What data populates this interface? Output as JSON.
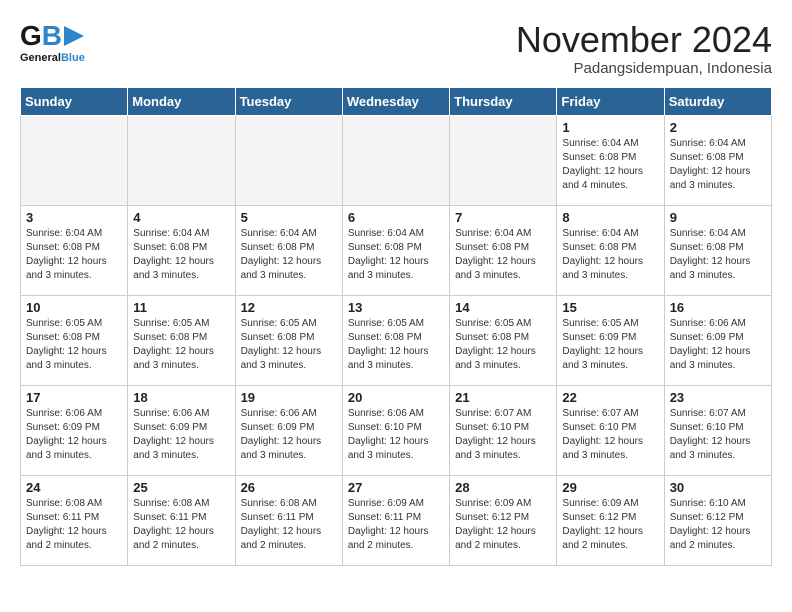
{
  "header": {
    "logo_general": "General",
    "logo_blue": "Blue",
    "month_title": "November 2024",
    "location": "Padangsidempuan, Indonesia"
  },
  "weekdays": [
    "Sunday",
    "Monday",
    "Tuesday",
    "Wednesday",
    "Thursday",
    "Friday",
    "Saturday"
  ],
  "weeks": [
    [
      {
        "day": "",
        "empty": true
      },
      {
        "day": "",
        "empty": true
      },
      {
        "day": "",
        "empty": true
      },
      {
        "day": "",
        "empty": true
      },
      {
        "day": "",
        "empty": true
      },
      {
        "day": "1",
        "sunrise": "Sunrise: 6:04 AM",
        "sunset": "Sunset: 6:08 PM",
        "daylight": "Daylight: 12 hours and 4 minutes."
      },
      {
        "day": "2",
        "sunrise": "Sunrise: 6:04 AM",
        "sunset": "Sunset: 6:08 PM",
        "daylight": "Daylight: 12 hours and 3 minutes."
      }
    ],
    [
      {
        "day": "3",
        "sunrise": "Sunrise: 6:04 AM",
        "sunset": "Sunset: 6:08 PM",
        "daylight": "Daylight: 12 hours and 3 minutes."
      },
      {
        "day": "4",
        "sunrise": "Sunrise: 6:04 AM",
        "sunset": "Sunset: 6:08 PM",
        "daylight": "Daylight: 12 hours and 3 minutes."
      },
      {
        "day": "5",
        "sunrise": "Sunrise: 6:04 AM",
        "sunset": "Sunset: 6:08 PM",
        "daylight": "Daylight: 12 hours and 3 minutes."
      },
      {
        "day": "6",
        "sunrise": "Sunrise: 6:04 AM",
        "sunset": "Sunset: 6:08 PM",
        "daylight": "Daylight: 12 hours and 3 minutes."
      },
      {
        "day": "7",
        "sunrise": "Sunrise: 6:04 AM",
        "sunset": "Sunset: 6:08 PM",
        "daylight": "Daylight: 12 hours and 3 minutes."
      },
      {
        "day": "8",
        "sunrise": "Sunrise: 6:04 AM",
        "sunset": "Sunset: 6:08 PM",
        "daylight": "Daylight: 12 hours and 3 minutes."
      },
      {
        "day": "9",
        "sunrise": "Sunrise: 6:04 AM",
        "sunset": "Sunset: 6:08 PM",
        "daylight": "Daylight: 12 hours and 3 minutes."
      }
    ],
    [
      {
        "day": "10",
        "sunrise": "Sunrise: 6:05 AM",
        "sunset": "Sunset: 6:08 PM",
        "daylight": "Daylight: 12 hours and 3 minutes."
      },
      {
        "day": "11",
        "sunrise": "Sunrise: 6:05 AM",
        "sunset": "Sunset: 6:08 PM",
        "daylight": "Daylight: 12 hours and 3 minutes."
      },
      {
        "day": "12",
        "sunrise": "Sunrise: 6:05 AM",
        "sunset": "Sunset: 6:08 PM",
        "daylight": "Daylight: 12 hours and 3 minutes."
      },
      {
        "day": "13",
        "sunrise": "Sunrise: 6:05 AM",
        "sunset": "Sunset: 6:08 PM",
        "daylight": "Daylight: 12 hours and 3 minutes."
      },
      {
        "day": "14",
        "sunrise": "Sunrise: 6:05 AM",
        "sunset": "Sunset: 6:08 PM",
        "daylight": "Daylight: 12 hours and 3 minutes."
      },
      {
        "day": "15",
        "sunrise": "Sunrise: 6:05 AM",
        "sunset": "Sunset: 6:09 PM",
        "daylight": "Daylight: 12 hours and 3 minutes."
      },
      {
        "day": "16",
        "sunrise": "Sunrise: 6:06 AM",
        "sunset": "Sunset: 6:09 PM",
        "daylight": "Daylight: 12 hours and 3 minutes."
      }
    ],
    [
      {
        "day": "17",
        "sunrise": "Sunrise: 6:06 AM",
        "sunset": "Sunset: 6:09 PM",
        "daylight": "Daylight: 12 hours and 3 minutes."
      },
      {
        "day": "18",
        "sunrise": "Sunrise: 6:06 AM",
        "sunset": "Sunset: 6:09 PM",
        "daylight": "Daylight: 12 hours and 3 minutes."
      },
      {
        "day": "19",
        "sunrise": "Sunrise: 6:06 AM",
        "sunset": "Sunset: 6:09 PM",
        "daylight": "Daylight: 12 hours and 3 minutes."
      },
      {
        "day": "20",
        "sunrise": "Sunrise: 6:06 AM",
        "sunset": "Sunset: 6:10 PM",
        "daylight": "Daylight: 12 hours and 3 minutes."
      },
      {
        "day": "21",
        "sunrise": "Sunrise: 6:07 AM",
        "sunset": "Sunset: 6:10 PM",
        "daylight": "Daylight: 12 hours and 3 minutes."
      },
      {
        "day": "22",
        "sunrise": "Sunrise: 6:07 AM",
        "sunset": "Sunset: 6:10 PM",
        "daylight": "Daylight: 12 hours and 3 minutes."
      },
      {
        "day": "23",
        "sunrise": "Sunrise: 6:07 AM",
        "sunset": "Sunset: 6:10 PM",
        "daylight": "Daylight: 12 hours and 3 minutes."
      }
    ],
    [
      {
        "day": "24",
        "sunrise": "Sunrise: 6:08 AM",
        "sunset": "Sunset: 6:11 PM",
        "daylight": "Daylight: 12 hours and 2 minutes."
      },
      {
        "day": "25",
        "sunrise": "Sunrise: 6:08 AM",
        "sunset": "Sunset: 6:11 PM",
        "daylight": "Daylight: 12 hours and 2 minutes."
      },
      {
        "day": "26",
        "sunrise": "Sunrise: 6:08 AM",
        "sunset": "Sunset: 6:11 PM",
        "daylight": "Daylight: 12 hours and 2 minutes."
      },
      {
        "day": "27",
        "sunrise": "Sunrise: 6:09 AM",
        "sunset": "Sunset: 6:11 PM",
        "daylight": "Daylight: 12 hours and 2 minutes."
      },
      {
        "day": "28",
        "sunrise": "Sunrise: 6:09 AM",
        "sunset": "Sunset: 6:12 PM",
        "daylight": "Daylight: 12 hours and 2 minutes."
      },
      {
        "day": "29",
        "sunrise": "Sunrise: 6:09 AM",
        "sunset": "Sunset: 6:12 PM",
        "daylight": "Daylight: 12 hours and 2 minutes."
      },
      {
        "day": "30",
        "sunrise": "Sunrise: 6:10 AM",
        "sunset": "Sunset: 6:12 PM",
        "daylight": "Daylight: 12 hours and 2 minutes."
      }
    ]
  ]
}
